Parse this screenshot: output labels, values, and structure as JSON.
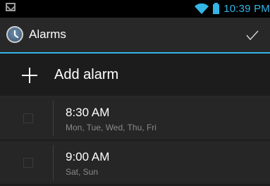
{
  "status_bar": {
    "time": "10:39 PM",
    "icons": [
      "mail-notification-icon",
      "wifi-icon",
      "battery-icon"
    ],
    "accent": "#33b5e5"
  },
  "action_bar": {
    "title": "Alarms",
    "icon": "alarm-clock-icon",
    "action_icon": "check-icon"
  },
  "add_alarm": {
    "label": "Add alarm",
    "icon": "plus-icon"
  },
  "alarms": [
    {
      "time": "8:30 AM",
      "days": "Mon, Tue, Wed, Thu, Fri",
      "enabled": false
    },
    {
      "time": "9:00 AM",
      "days": "Sat, Sun",
      "enabled": false
    }
  ]
}
